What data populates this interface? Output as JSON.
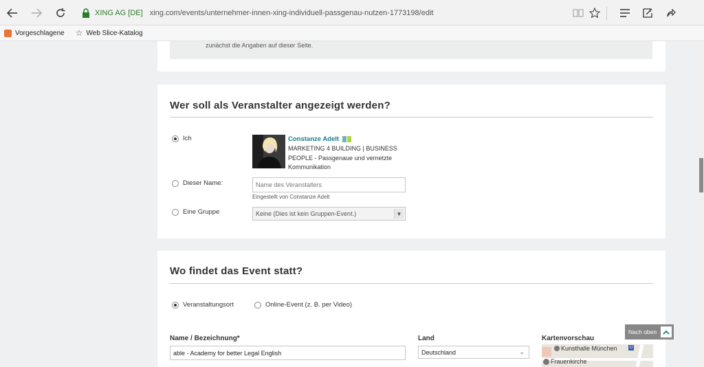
{
  "browser": {
    "site_identity": "XING AG [DE]",
    "url": "xing.com/events/unternehmer-innen-xing-individuell-passgenau-nutzen-1773198/edit",
    "favorites": [
      {
        "label": "Vorgeschlagene"
      },
      {
        "label": "Web Slice-Katalog"
      }
    ]
  },
  "note": {
    "text": "zunächst die Angaben auf dieser Seite."
  },
  "organizer": {
    "heading": "Wer soll als Veranstalter angezeigt werden?",
    "option_me": "Ich",
    "person_name": "Constanze Adelt",
    "person_desc": "MARKETING 4 BUILDING | BUSINESS PEOPLE - Passgenaue und vernetzte Kommunikation",
    "option_name": "Dieser Name:",
    "name_placeholder": "Name des Veranstalters",
    "name_hint": "Eingestellt von Constanze Adelt",
    "option_group": "Eine Gruppe",
    "group_select": "Keine (Dies ist kein Gruppen-Event.)",
    "selected": "me"
  },
  "location": {
    "heading": "Wo findet das Event statt?",
    "option_venue": "Veranstaltungsort",
    "option_online": "Online-Event (z. B. per Video)",
    "selected": "venue",
    "name_label": "Name / Bezeichnung*",
    "name_value": "able - Academy for better Legal English",
    "country_label": "Land",
    "country_value": "Deutschland",
    "map_label": "Kartenvorschau",
    "map_places": [
      "Kunsthalle München",
      "Frauenkirche"
    ]
  },
  "scroll_top_label": "Nach oben",
  "colors": {
    "accent_teal": "#127e85",
    "secure_green": "#2a7d2a"
  }
}
